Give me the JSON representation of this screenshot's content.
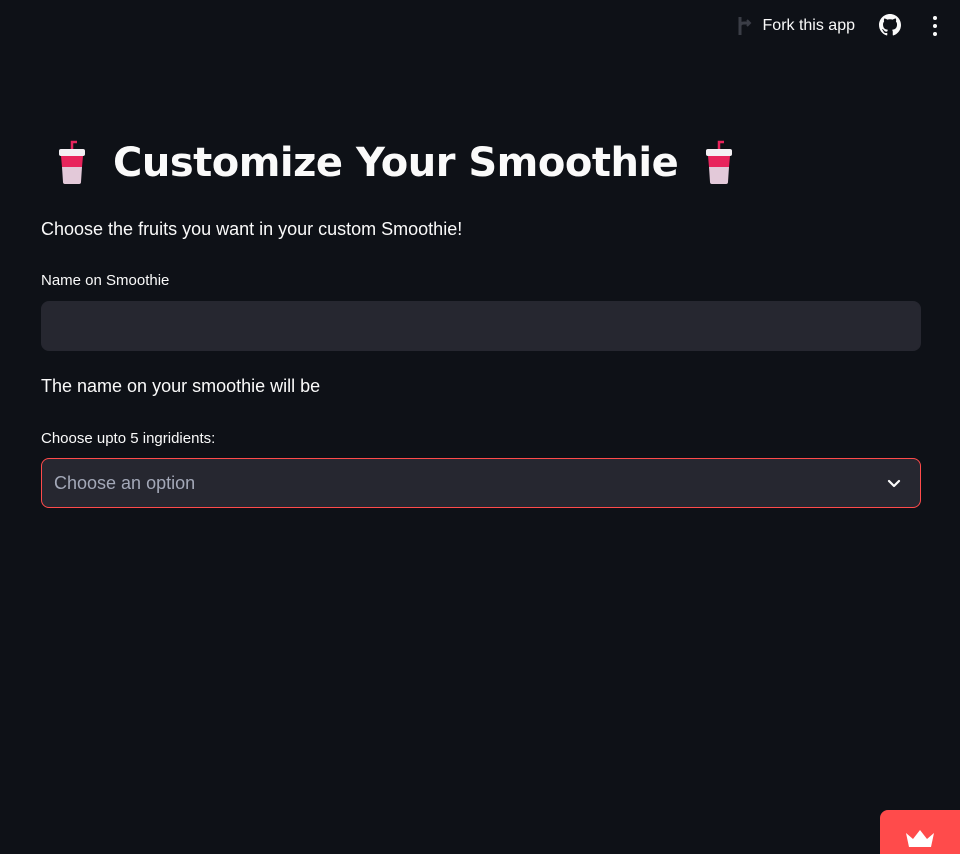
{
  "toolbar": {
    "fork_label": "Fork this app",
    "icons": [
      "fork-icon",
      "github-icon",
      "more-vert-icon"
    ]
  },
  "main": {
    "title": "Customize Your Smoothie",
    "title_icon": "cup-with-straw-icon",
    "subtitle": "Choose the fruits you want in your custom Smoothie!",
    "name_label": "Name on Smoothie",
    "name_value": "",
    "name_result": "The name on your smoothie will be",
    "ingredients_label": "Choose upto 5 ingridients:",
    "ingredients_placeholder": "Choose an option"
  },
  "footer": {
    "badge_icon": "streamlit-crown-icon"
  },
  "colors": {
    "background": "#0e1117",
    "input_bg": "#262730",
    "accent": "#ff4b4b",
    "text": "#fafafa",
    "placeholder": "#a3a8b8"
  }
}
